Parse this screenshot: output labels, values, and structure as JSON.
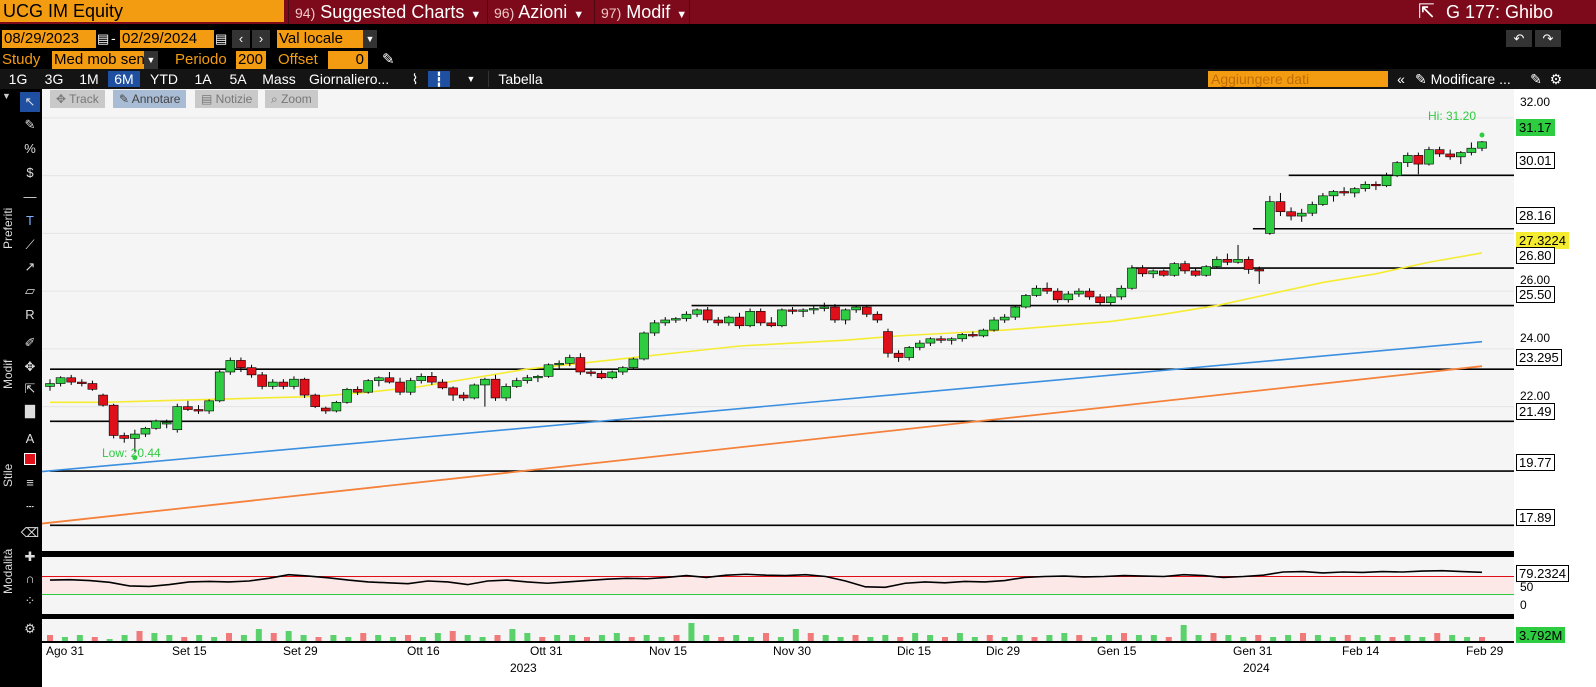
{
  "header": {
    "ticker": "UCG IM Equity",
    "menus": [
      {
        "num": "94)",
        "label": "Suggested Charts"
      },
      {
        "num": "96)",
        "label": "Azioni"
      },
      {
        "num": "97)",
        "label": "Modif"
      }
    ],
    "right_title": "G 177: Ghibo"
  },
  "range": {
    "start": "08/29/2023",
    "end": "02/29/2024",
    "dash": "-",
    "currency": "Val locale"
  },
  "study": {
    "label": "Study",
    "value": "Med mob sen",
    "period_label": "Periodo",
    "period": "200",
    "offset_label": "Offset",
    "offset": "0"
  },
  "toolbar": {
    "ranges": [
      "1G",
      "3G",
      "1M",
      "6M",
      "YTD",
      "1A",
      "5A",
      "Mass"
    ],
    "selected": "6M",
    "interval": "Giornaliero...",
    "table": "Tabella",
    "add_data_placeholder": "Aggiungere dati",
    "modify": "Modificare ..."
  },
  "plot_tools": [
    "Track",
    "Annotare",
    "Notizie",
    "Zoom"
  ],
  "sidebar": {
    "preferiti": "Preferiti",
    "modif": "Modif",
    "stile": "Stile",
    "modalita": "Modalità"
  },
  "price_axis": {
    "ticks": [
      "32.00",
      "26.00",
      "24.00",
      "22.00"
    ],
    "levels": [
      "31.17",
      "30.01",
      "28.16",
      "27.3224",
      "26.80",
      "25.50",
      "23.295",
      "21.49",
      "19.77",
      "17.89"
    ],
    "rsi_value": "79.2324",
    "rsi_ticks": [
      "50",
      "0"
    ],
    "volume_value": "3.792M"
  },
  "annotations": {
    "high": "Hi: 31.20",
    "low": "Low: 20.44"
  },
  "time_axis": [
    "Ago 31",
    "Set 15",
    "Set 29",
    "Ott 16",
    "Ott 31",
    "Nov 15",
    "Nov 30",
    "Dic 15",
    "Dic 29",
    "Gen 15",
    "Gen 31",
    "Feb 14",
    "Feb 29"
  ],
  "years": [
    "2023",
    "2024"
  ],
  "colors": {
    "header_bg": "#7d0a1a",
    "accent": "#f39c12",
    "up": "#2ecc40",
    "down": "#e0101a",
    "ma50": "#f5ec32",
    "trend": "#3a8fe0",
    "ma200": "#f5813b"
  },
  "chart_data": {
    "type": "candlestick",
    "ylim": [
      17.0,
      33.0
    ],
    "candles": [
      [
        22.7,
        22.95,
        22.55,
        22.8
      ],
      [
        22.8,
        23.05,
        22.7,
        23.0
      ],
      [
        23.0,
        23.1,
        22.75,
        22.85
      ],
      [
        22.85,
        22.95,
        22.7,
        22.8
      ],
      [
        22.8,
        22.9,
        22.55,
        22.6
      ],
      [
        22.4,
        22.45,
        22.0,
        22.05
      ],
      [
        22.05,
        22.1,
        20.9,
        21.0
      ],
      [
        21.0,
        21.1,
        20.75,
        20.9
      ],
      [
        20.9,
        21.2,
        20.44,
        21.05
      ],
      [
        21.05,
        21.3,
        20.95,
        21.25
      ],
      [
        21.25,
        21.55,
        21.2,
        21.5
      ],
      [
        21.4,
        21.55,
        21.25,
        21.45
      ],
      [
        21.2,
        22.1,
        21.1,
        22.0
      ],
      [
        22.0,
        22.2,
        21.85,
        21.9
      ],
      [
        21.9,
        22.05,
        21.75,
        21.85
      ],
      [
        21.85,
        22.25,
        21.75,
        22.2
      ],
      [
        22.2,
        23.3,
        22.15,
        23.2
      ],
      [
        23.2,
        23.7,
        23.1,
        23.6
      ],
      [
        23.6,
        23.7,
        23.2,
        23.35
      ],
      [
        23.35,
        23.45,
        23.0,
        23.1
      ],
      [
        23.1,
        23.2,
        22.6,
        22.7
      ],
      [
        22.7,
        22.95,
        22.6,
        22.85
      ],
      [
        22.85,
        22.95,
        22.6,
        22.7
      ],
      [
        22.7,
        23.05,
        22.6,
        22.95
      ],
      [
        22.95,
        23.0,
        22.3,
        22.4
      ],
      [
        22.4,
        22.45,
        21.95,
        22.0
      ],
      [
        21.95,
        22.0,
        21.75,
        21.85
      ],
      [
        21.85,
        22.2,
        21.8,
        22.15
      ],
      [
        22.15,
        22.65,
        22.1,
        22.6
      ],
      [
        22.6,
        22.7,
        22.4,
        22.5
      ],
      [
        22.5,
        22.95,
        22.45,
        22.9
      ],
      [
        22.9,
        23.05,
        22.7,
        23.0
      ],
      [
        23.0,
        23.2,
        22.8,
        22.85
      ],
      [
        22.85,
        23.0,
        22.4,
        22.5
      ],
      [
        22.5,
        23.0,
        22.4,
        22.9
      ],
      [
        22.9,
        23.15,
        22.8,
        23.05
      ],
      [
        23.05,
        23.2,
        22.75,
        22.85
      ],
      [
        22.85,
        22.95,
        22.6,
        22.65
      ],
      [
        22.65,
        22.7,
        22.2,
        22.4
      ],
      [
        22.4,
        22.5,
        22.2,
        22.3
      ],
      [
        22.3,
        22.8,
        22.25,
        22.75
      ],
      [
        22.75,
        23.0,
        22.0,
        22.95
      ],
      [
        22.95,
        23.1,
        22.2,
        22.3
      ],
      [
        22.3,
        22.8,
        22.2,
        22.7
      ],
      [
        22.7,
        23.0,
        22.65,
        22.9
      ],
      [
        22.9,
        23.1,
        22.8,
        23.0
      ],
      [
        23.0,
        23.1,
        22.85,
        23.05
      ],
      [
        23.05,
        23.5,
        23.0,
        23.45
      ],
      [
        23.45,
        23.6,
        23.3,
        23.5
      ],
      [
        23.5,
        23.8,
        23.4,
        23.7
      ],
      [
        23.7,
        23.85,
        23.1,
        23.2
      ],
      [
        23.2,
        23.3,
        23.05,
        23.15
      ],
      [
        23.15,
        23.25,
        22.95,
        23.0
      ],
      [
        23.0,
        23.25,
        22.95,
        23.2
      ],
      [
        23.2,
        23.4,
        23.1,
        23.35
      ],
      [
        23.35,
        23.7,
        23.3,
        23.65
      ],
      [
        23.65,
        24.6,
        23.6,
        24.55
      ],
      [
        24.55,
        25.0,
        24.45,
        24.9
      ],
      [
        24.9,
        25.1,
        24.8,
        25.0
      ],
      [
        25.0,
        25.1,
        24.9,
        25.05
      ],
      [
        25.05,
        25.3,
        24.95,
        25.2
      ],
      [
        25.2,
        25.4,
        25.1,
        25.35
      ],
      [
        25.35,
        25.45,
        24.9,
        25.0
      ],
      [
        25.0,
        25.1,
        24.8,
        24.9
      ],
      [
        24.9,
        25.15,
        24.8,
        25.1
      ],
      [
        25.1,
        25.25,
        24.7,
        24.8
      ],
      [
        24.8,
        25.4,
        24.75,
        25.3
      ],
      [
        25.3,
        25.4,
        24.8,
        24.9
      ],
      [
        24.9,
        25.1,
        24.75,
        24.8
      ],
      [
        24.8,
        25.4,
        24.75,
        25.35
      ],
      [
        25.35,
        25.45,
        25.2,
        25.3
      ],
      [
        25.3,
        25.4,
        25.1,
        25.35
      ],
      [
        25.35,
        25.5,
        25.2,
        25.4
      ],
      [
        25.4,
        25.6,
        25.3,
        25.45
      ],
      [
        25.45,
        25.55,
        24.9,
        25.0
      ],
      [
        25.0,
        25.4,
        24.85,
        25.35
      ],
      [
        25.35,
        25.5,
        25.25,
        25.45
      ],
      [
        25.45,
        25.5,
        25.1,
        25.2
      ],
      [
        25.2,
        25.3,
        24.9,
        25.0
      ],
      [
        24.6,
        24.7,
        23.7,
        23.85
      ],
      [
        23.85,
        23.95,
        23.55,
        23.7
      ],
      [
        23.7,
        24.1,
        23.6,
        24.05
      ],
      [
        24.05,
        24.3,
        23.95,
        24.2
      ],
      [
        24.2,
        24.4,
        24.1,
        24.35
      ],
      [
        24.35,
        24.45,
        24.2,
        24.3
      ],
      [
        24.3,
        24.4,
        24.15,
        24.35
      ],
      [
        24.35,
        24.55,
        24.25,
        24.5
      ],
      [
        24.5,
        24.6,
        24.4,
        24.45
      ],
      [
        24.45,
        24.7,
        24.4,
        24.65
      ],
      [
        24.65,
        25.1,
        24.6,
        25.0
      ],
      [
        25.0,
        25.2,
        24.9,
        25.1
      ],
      [
        25.1,
        25.5,
        25.0,
        25.45
      ],
      [
        25.45,
        25.9,
        25.4,
        25.85
      ],
      [
        25.85,
        26.2,
        25.8,
        26.1
      ],
      [
        26.1,
        26.3,
        25.9,
        26.0
      ],
      [
        26.0,
        26.1,
        25.6,
        25.7
      ],
      [
        25.7,
        26.0,
        25.6,
        25.9
      ],
      [
        25.9,
        26.1,
        25.8,
        26.0
      ],
      [
        26.0,
        26.1,
        25.7,
        25.8
      ],
      [
        25.8,
        25.9,
        25.5,
        25.6
      ],
      [
        25.6,
        25.9,
        25.5,
        25.8
      ],
      [
        25.8,
        26.2,
        25.7,
        26.1
      ],
      [
        26.1,
        26.9,
        26.05,
        26.8
      ],
      [
        26.8,
        26.9,
        26.5,
        26.6
      ],
      [
        26.6,
        26.75,
        26.45,
        26.7
      ],
      [
        26.7,
        26.75,
        26.5,
        26.55
      ],
      [
        26.55,
        27.0,
        26.5,
        26.95
      ],
      [
        26.95,
        27.05,
        26.6,
        26.7
      ],
      [
        26.7,
        26.8,
        26.5,
        26.55
      ],
      [
        26.55,
        26.9,
        26.5,
        26.85
      ],
      [
        26.85,
        27.2,
        26.8,
        27.1
      ],
      [
        27.1,
        27.3,
        26.9,
        27.0
      ],
      [
        27.0,
        27.6,
        26.95,
        27.1
      ],
      [
        27.1,
        27.2,
        26.6,
        26.75
      ],
      [
        26.75,
        26.85,
        26.25,
        26.7
      ],
      [
        28.0,
        29.3,
        27.95,
        29.1
      ],
      [
        29.1,
        29.4,
        28.6,
        28.75
      ],
      [
        28.75,
        28.9,
        28.45,
        28.6
      ],
      [
        28.6,
        28.85,
        28.4,
        28.7
      ],
      [
        28.7,
        29.1,
        28.6,
        29.0
      ],
      [
        29.0,
        29.4,
        28.95,
        29.3
      ],
      [
        29.3,
        29.5,
        29.1,
        29.45
      ],
      [
        29.45,
        29.6,
        29.3,
        29.4
      ],
      [
        29.4,
        29.6,
        29.25,
        29.55
      ],
      [
        29.55,
        29.8,
        29.45,
        29.7
      ],
      [
        29.7,
        29.8,
        29.5,
        29.65
      ],
      [
        29.65,
        30.1,
        29.6,
        30.0
      ],
      [
        30.0,
        30.5,
        29.95,
        30.45
      ],
      [
        30.45,
        30.8,
        30.3,
        30.7
      ],
      [
        30.7,
        30.8,
        30.05,
        30.4
      ],
      [
        30.4,
        31.0,
        30.35,
        30.9
      ],
      [
        30.9,
        31.0,
        30.65,
        30.75
      ],
      [
        30.75,
        30.9,
        30.55,
        30.65
      ],
      [
        30.65,
        30.85,
        30.4,
        30.8
      ],
      [
        30.8,
        31.15,
        30.7,
        30.95
      ],
      [
        30.95,
        31.2,
        30.85,
        31.17
      ]
    ],
    "horizontal_levels": [
      {
        "value": 30.01,
        "from": 0.865
      },
      {
        "value": 28.16,
        "from": 0.84
      },
      {
        "value": 26.8,
        "from": 0.755
      },
      {
        "value": 25.5,
        "from": 0.448
      },
      {
        "value": 23.295,
        "from": 0
      },
      {
        "value": 21.49,
        "from": 0
      },
      {
        "value": 19.77,
        "from": 0
      },
      {
        "value": 17.89,
        "from": 0
      }
    ],
    "trend_line": {
      "start": 19.75,
      "end": 24.25
    },
    "ma200": {
      "start": 17.95,
      "end": 23.4
    },
    "ma50": [
      22.15,
      22.15,
      22.2,
      22.25,
      22.3,
      22.35,
      22.5,
      22.7,
      23.0,
      23.3,
      23.5,
      23.7,
      23.9,
      24.1,
      24.2,
      24.3,
      24.45,
      24.55,
      24.65,
      24.8,
      24.95,
      25.2,
      25.5,
      25.9,
      26.3,
      26.6,
      27.0,
      27.3224
    ],
    "rsi": [
      62,
      63,
      61,
      57,
      49,
      48,
      52,
      58,
      59,
      58,
      60,
      66,
      74,
      71,
      67,
      62,
      58,
      56,
      54,
      60,
      58,
      52,
      60,
      62,
      58,
      55,
      58,
      61,
      64,
      66,
      65,
      68,
      72,
      68,
      73,
      75,
      73,
      72,
      74,
      70,
      60,
      47,
      46,
      55,
      58,
      56,
      59,
      58,
      61,
      68,
      70,
      71,
      69,
      70,
      72,
      71,
      70,
      74,
      72,
      68,
      70,
      73,
      80,
      81,
      78,
      80,
      79,
      81,
      80,
      82,
      83,
      81,
      79.2324
    ],
    "volume": [
      3,
      2,
      3,
      2,
      1,
      3,
      5,
      4,
      3,
      2,
      3,
      2,
      4,
      3,
      6,
      4,
      5,
      3,
      2,
      3,
      2,
      4,
      3,
      2,
      3,
      2,
      4,
      5,
      3,
      2,
      3,
      6,
      4,
      2,
      3,
      3,
      2,
      3,
      4,
      2,
      3,
      2,
      3,
      9,
      3,
      2,
      3,
      2,
      4,
      2,
      6,
      4,
      3,
      2,
      3,
      2,
      3,
      2,
      4,
      3,
      2,
      4,
      2,
      3,
      2,
      3,
      2,
      3,
      4,
      3,
      2,
      3,
      4,
      3,
      3,
      2,
      8,
      3,
      4,
      3,
      2,
      3,
      2,
      3,
      4,
      3,
      2,
      3,
      2,
      3,
      2,
      3,
      2,
      4,
      3,
      2,
      2
    ]
  }
}
